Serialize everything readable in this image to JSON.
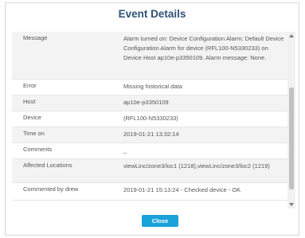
{
  "dialog": {
    "title": "Event Details",
    "close_label": "Close"
  },
  "rows": [
    {
      "label": "Message",
      "value": "Alarm turned on: Device Configuration Alarm: Default Device Configuration Alarm for device (RFL100-N5330233) on Device Host ap10e-p3350109. Alarm message: None."
    },
    {
      "label": "Error",
      "value": "Missing historical data"
    },
    {
      "label": "Host",
      "value": "ap10e-p3350109"
    },
    {
      "label": "Device",
      "value": "(RFL100-N5330233)"
    },
    {
      "label": "Time on",
      "value": "2019-01-21 13:32:14"
    },
    {
      "label": "Comments",
      "value": "_"
    },
    {
      "label": "Affected Locations",
      "value": "viewLinc/zone3/loc1 (1218),viewLinc/zone3/loc2 (1219)"
    },
    {
      "label": "Commented by drew",
      "value": "2019-01-21 15:13:24 - Checked device - OK"
    }
  ],
  "scrollbar": {
    "up_icon": "chevron-up-icon",
    "down_icon": "chevron-down-icon"
  }
}
